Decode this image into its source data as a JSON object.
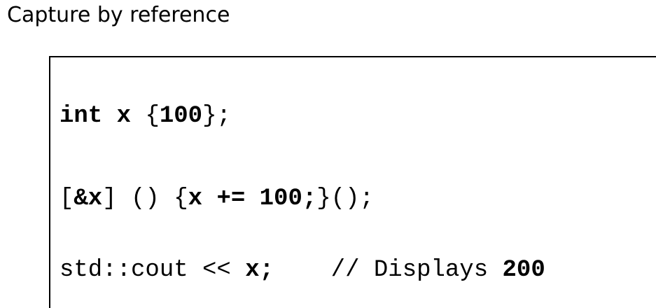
{
  "slide": {
    "title": "Capture by reference"
  },
  "code": {
    "line1": {
      "kw_int": "int",
      "sp1": " ",
      "var_x": "x",
      "sp2": " ",
      "brace_open": "{",
      "value": "100",
      "brace_close_semi": "};"
    },
    "line2": {
      "bracket_open": "[",
      "capture": "&x",
      "bracket_close_parens": "] () {",
      "body": "x += 100;",
      "tail": "}();"
    },
    "line3": {
      "stream": "std::cout << ",
      "var_x_semi": "x;",
      "comment": "    // Displays ",
      "result": "200"
    }
  }
}
